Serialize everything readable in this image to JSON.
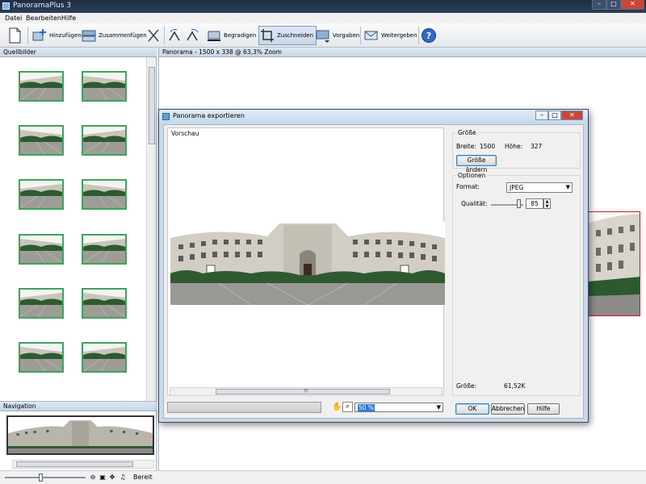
{
  "app": {
    "title": "PanoramaPlus 3",
    "minimize": "–",
    "maximize": "□",
    "close": "✕"
  },
  "menu": [
    "Datei",
    "Bearbeiten",
    "Hilfe"
  ],
  "toolbar": {
    "add_label": "Hinzufügen",
    "merge_label": "Zusammenfügen",
    "straighten_label": "Begradigen",
    "crop_label": "Zuschneiden",
    "presets_label": "Vorgaben",
    "share_label": "Weitergeben"
  },
  "left_pane": {
    "title": "Quellbilder"
  },
  "nav_pane": {
    "title": "Navigation"
  },
  "right_pane": {
    "title": "Panorama - 1500 x 338 @ 63,3% Zoom"
  },
  "statusbar": {
    "status": "Bereit"
  },
  "dialog": {
    "title": "Panorama exportieren",
    "preview_label": "Vorschau",
    "size_group": "Größe",
    "width_label": "Breite:",
    "width_value": "1500",
    "height_label": "Höhe:",
    "height_value": "327",
    "resize_button": "Größe ändern",
    "options_group": "Optionen",
    "format_label": "Format:",
    "format_value": "JPEG",
    "quality_label": "Qualität:",
    "quality_value": "85",
    "quality_fraction": 0.85,
    "filesize_label": "Größe:",
    "filesize_value": "61,52K",
    "zoom_value": "50 %",
    "ok_button": "OK",
    "cancel_button": "Abbrechen",
    "help_button": "Hilfe",
    "scroll_grip": "⦙⦙⦙"
  },
  "icons": [
    "new-document-icon",
    "add-images-icon",
    "merge-icon",
    "cut-icon",
    "rotate-left-icon",
    "rotate-right-icon",
    "straighten-icon",
    "crop-icon",
    "presets-icon",
    "share-icon",
    "help-icon",
    "zoom-out-icon",
    "zoom-in-icon",
    "fit-icon",
    "hand-icon",
    "search-icon"
  ],
  "colors": {
    "thumb_border": "#3fa35a",
    "selection_border": "#d11111",
    "titlebar": "#1f2e45"
  }
}
